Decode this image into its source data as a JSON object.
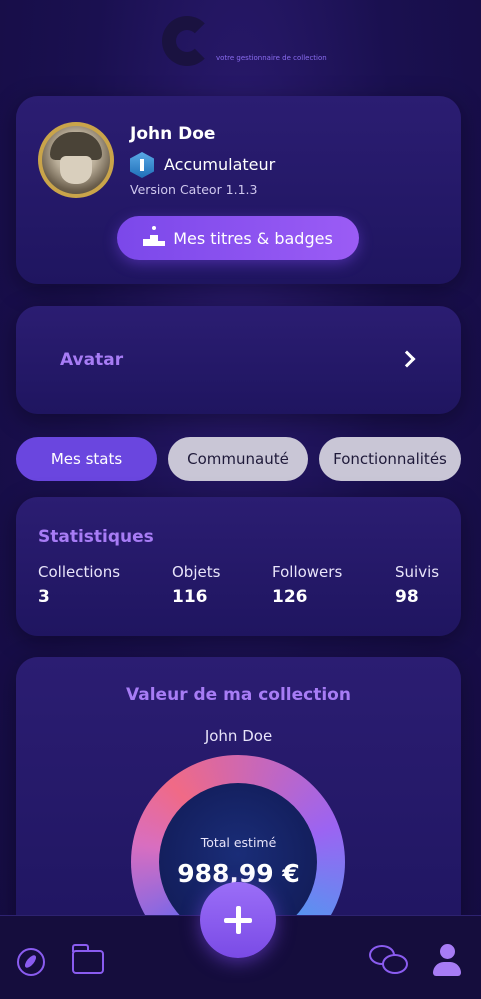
{
  "logo": {
    "subtitle": "votre gestionnaire de collection"
  },
  "profile": {
    "username": "John Doe",
    "rank": "Accumulateur",
    "version": "Version Cateor 1.1.3",
    "badges_button": "Mes titres & badges"
  },
  "avatar_card": {
    "label": "Avatar"
  },
  "tabs": [
    {
      "label": "Mes stats",
      "active": true
    },
    {
      "label": "Communauté",
      "active": false
    },
    {
      "label": "Fonctionnalités",
      "active": false
    }
  ],
  "stats": {
    "title": "Statistiques",
    "items": [
      {
        "label": "Collections",
        "value": "3"
      },
      {
        "label": "Objets",
        "value": "116"
      },
      {
        "label": "Followers",
        "value": "126"
      },
      {
        "label": "Suivis",
        "value": "98"
      }
    ]
  },
  "collection_value": {
    "title": "Valeur de ma collection",
    "owner": "John Doe",
    "total_label": "Total estimé",
    "total_value": "988,99 €"
  },
  "colors": {
    "accent": "#7b48ea",
    "section_title": "#a77cf5",
    "background": "#1a1050"
  },
  "nav": {
    "icons": [
      "compass-icon",
      "folder-icon",
      "add-icon",
      "chat-icon",
      "user-icon"
    ]
  }
}
